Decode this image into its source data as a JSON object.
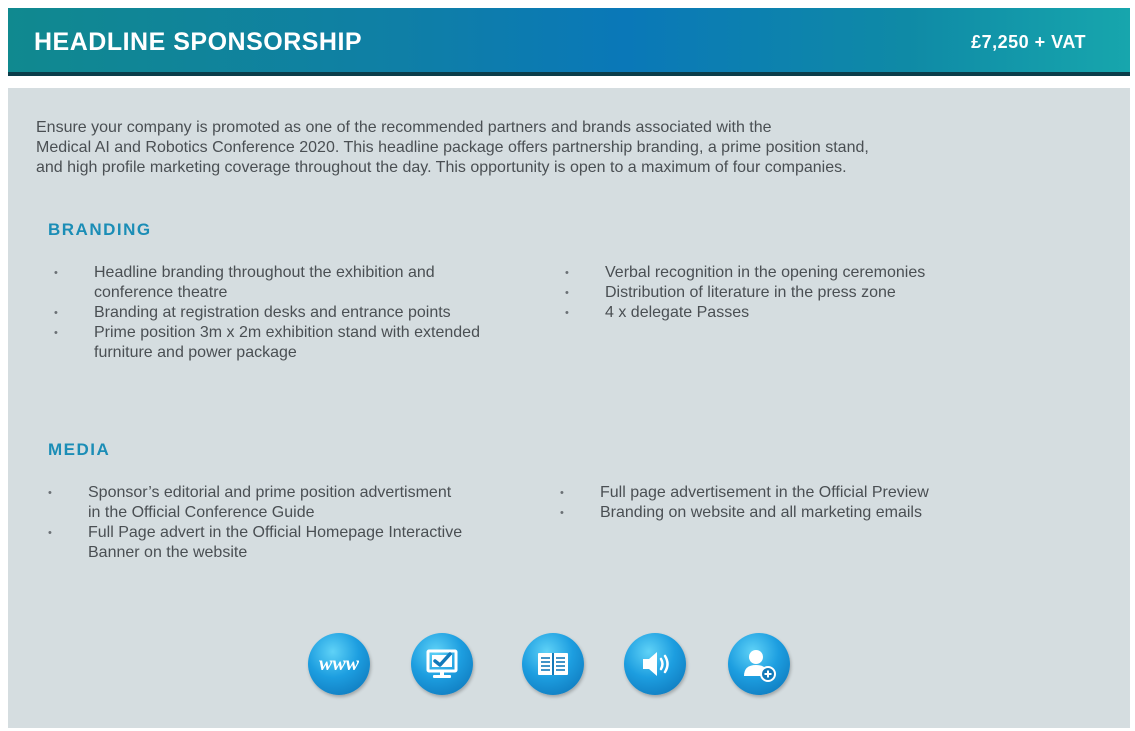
{
  "header": {
    "title": "HEADLINE SPONSORSHIP",
    "price": "£7,250 + VAT"
  },
  "intro": {
    "line1": "Ensure your company is promoted as one of the recommended partners and brands associated with the",
    "line2": "Medical AI and Robotics Conference 2020. This headline package offers partnership branding, a prime position stand,",
    "line3": "and high profile marketing coverage throughout the day. This opportunity is open to a maximum of four companies."
  },
  "branding": {
    "title": "BRANDING",
    "left": [
      "Headline branding throughout the exhibition and conference theatre",
      "Branding at registration desks and entrance points",
      "Prime position 3m x 2m exhibition stand with extended furniture and power package"
    ],
    "right": [
      "Verbal recognition in the opening ceremonies",
      "Distribution of literature in the press zone",
      "4 x delegate Passes"
    ]
  },
  "media": {
    "title": "MEDIA",
    "left": [
      "Sponsor’s editorial and prime position advertisment in the Official Conference Guide",
      "Full Page advert in the Official Homepage Interactive Banner on the website"
    ],
    "right": [
      "Full page advertisement in the Official Preview",
      "Branding on website and all marketing emails"
    ]
  },
  "icons": {
    "www_label": "www",
    "items": [
      "www-icon",
      "monitor-check-icon",
      "book-icon",
      "speaker-icon",
      "add-user-icon"
    ]
  },
  "colors": {
    "accent": "#1b8db6",
    "panel": "#d5dde0",
    "text": "#4a4f53"
  }
}
